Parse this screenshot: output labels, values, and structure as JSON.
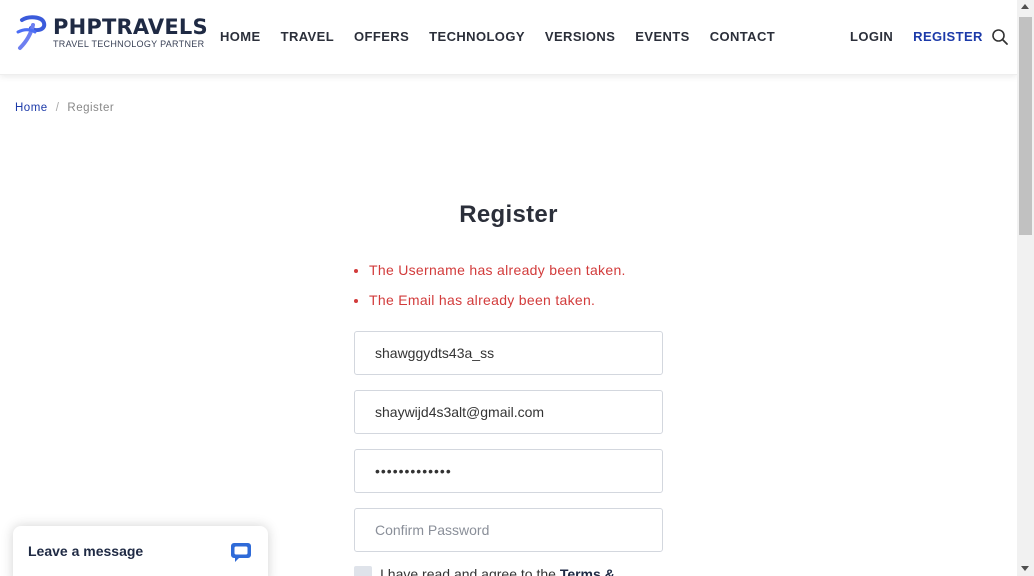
{
  "brand": {
    "title": "PHPTRAVELS",
    "subtitle": "TRAVEL TECHNOLOGY PARTNER",
    "accent_color": "#1c3aa9",
    "logo_icon": "phptravels-logo-icon"
  },
  "nav": {
    "items": [
      {
        "label": "HOME"
      },
      {
        "label": "TRAVEL"
      },
      {
        "label": "OFFERS"
      },
      {
        "label": "TECHNOLOGY"
      },
      {
        "label": "VERSIONS"
      },
      {
        "label": "EVENTS"
      },
      {
        "label": "CONTACT"
      }
    ],
    "login": "LOGIN",
    "register": "REGISTER",
    "search_icon": "search-icon"
  },
  "breadcrumb": {
    "home": "Home",
    "separator": "/",
    "current": "Register"
  },
  "form": {
    "title": "Register",
    "errors": [
      "The Username has already been taken.",
      "The Email has already been taken."
    ],
    "error_color": "#d23b3b",
    "username_value": "shawggydts43a_ss",
    "email_value": "shaywijd4s3alt@gmail.com",
    "password_value": "•••••••••••••",
    "confirm_password_placeholder": "Confirm Password",
    "terms_text": "I have read and agree to the ",
    "terms_link": "Terms &"
  },
  "chat": {
    "label": "Leave a message",
    "icon": "chat-bubble-icon"
  }
}
